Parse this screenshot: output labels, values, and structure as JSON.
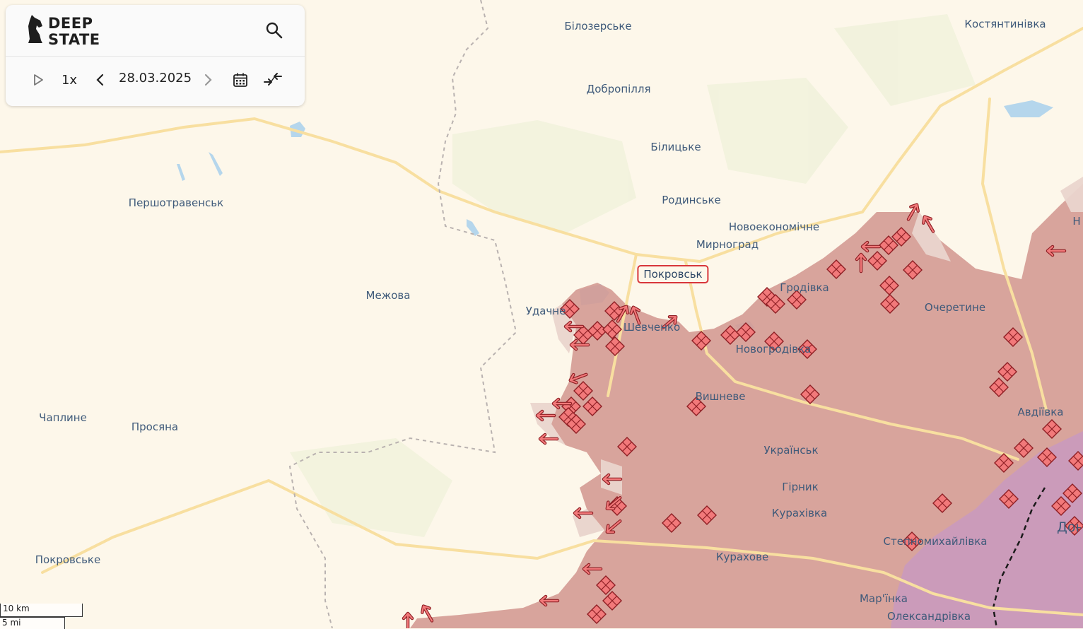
{
  "app": {
    "logo_line1": "DEEP",
    "logo_line2": "STATE"
  },
  "toolbar": {
    "speed": "1x",
    "date": "28.03.2025"
  },
  "icons": {
    "search": "search-icon",
    "play": "play-icon",
    "prev": "chevron-left-icon",
    "next": "chevron-right-icon",
    "calendar": "calendar-icon",
    "compare": "compare-icon"
  },
  "colors": {
    "occupied": "#d49a94",
    "contested": "#ead5cd",
    "marker": "#f2797a",
    "road": "#f8dfa0",
    "selected_outline": "#d8363a"
  },
  "places": {
    "bilozerske": "Білозерське",
    "kostiantynivka": "Костянтинівка",
    "dobropillia": "Добропілля",
    "bilytske": "Білицьке",
    "rodynske": "Родинське",
    "pershotravensk": "Першотравенськ",
    "novoekonomichne": "Новоекономічне",
    "myrnohrad": "Мирноград",
    "pokrovsk": "Покровськ",
    "hrodivka": "Гродівка",
    "ocheretyne": "Очеретине",
    "mezhova": "Межова",
    "udachne": "Удачне",
    "shevchenko": "Шевченко",
    "novohrodivka": "Новогродівка",
    "vyshneve": "Вишневе",
    "avdiivka": "Авдіївка",
    "chapline": "Чаплине",
    "prosiana": "Просяна",
    "ukrainsk": "Українськ",
    "hirnyk": "Гірник",
    "kurakhivka": "Курахівка",
    "stepnomykhailivka": "Степномихайлівка",
    "kurakhove": "Курахове",
    "pokrovske": "Покровське",
    "marinka": "Мар'їнка",
    "oleksandrivka": "Олександрівка",
    "donetsk": "Донецьк",
    "cut_right": "Н"
  },
  "scale": {
    "km": "10 km",
    "mi": "5 mi"
  }
}
